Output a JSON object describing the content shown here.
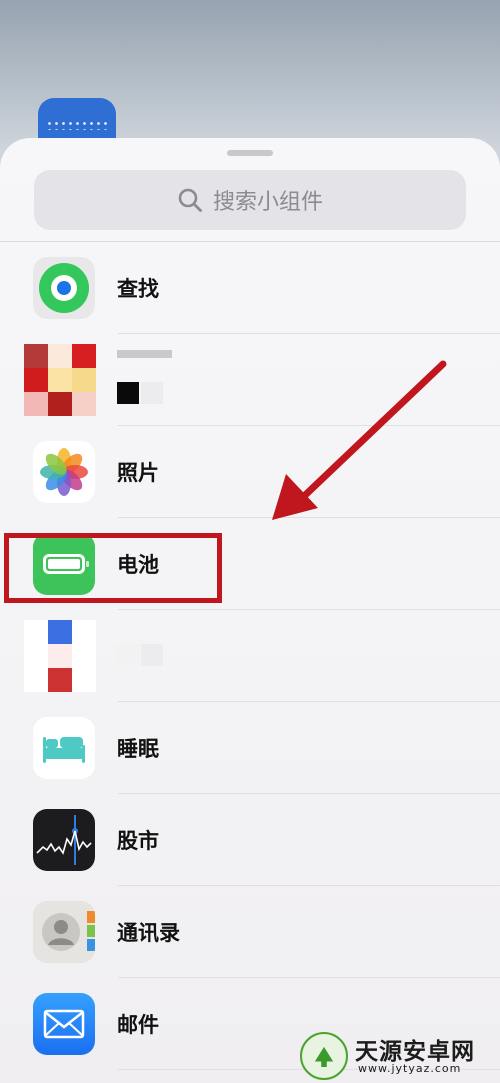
{
  "search": {
    "placeholder": "搜索小组件"
  },
  "widgets": [
    {
      "label": "查找",
      "icon": "find-my-icon"
    },
    {
      "label": "",
      "icon": "pixelated-app-icon"
    },
    {
      "label": "照片",
      "icon": "photos-icon"
    },
    {
      "label": "电池",
      "icon": "battery-icon"
    },
    {
      "label": "",
      "icon": "pixelated-app-icon"
    },
    {
      "label": "睡眠",
      "icon": "sleep-icon"
    },
    {
      "label": "股市",
      "icon": "stocks-icon"
    },
    {
      "label": "通讯录",
      "icon": "contacts-icon"
    },
    {
      "label": "邮件",
      "icon": "mail-icon"
    }
  ],
  "annotation": {
    "highlight_color": "#c0161e",
    "arrow_color": "#c0161e",
    "highlighted_item": "电池"
  },
  "watermark": {
    "title": "天源安卓网",
    "url": "www.jytyaz.com"
  }
}
